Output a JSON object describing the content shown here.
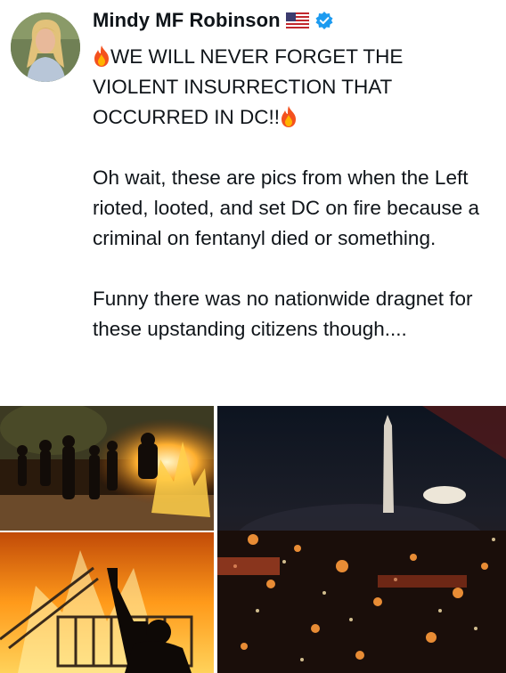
{
  "author": {
    "name": "Mindy MF Robinson",
    "flag_icon": "us-flag-icon",
    "verified_icon": "verified-badge-icon",
    "verified_color": "#1d9bf0"
  },
  "post": {
    "line1": "WE WILL NEVER FORGET THE VIOLENT INSURRECTION THAT OCCURRED IN DC!!",
    "fire_icon": "fire-emoji-icon",
    "para2": "Oh wait, these are pics from when the Left rioted, looted, and set DC on fire because a criminal on fentanyl died or something.",
    "para3": "Funny there was no nationwide dragnet for these upstanding citizens though...."
  },
  "media": {
    "images": [
      "protest-street-fire-photo",
      "burning-barricade-fist-photo",
      "washington-monument-night-fires-photo"
    ]
  }
}
